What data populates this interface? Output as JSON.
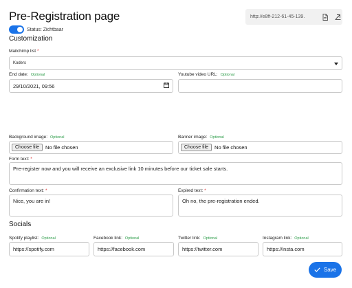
{
  "header": {
    "title": "Pre-Registration page",
    "status_label": "Status: Zichtbaar",
    "toggle_on": true,
    "url": "http://e8ff-212-61-45-139.",
    "file_icon": "document-icon",
    "open_icon": "external-link-icon"
  },
  "customization": {
    "title": "Customization",
    "required_mark": "*",
    "optional_label": "Optional",
    "mailchimp": {
      "label": "Mailchimp list",
      "value": "Koders"
    },
    "end_date": {
      "label": "End date:",
      "value": "29/10/2021, 09:56"
    },
    "youtube": {
      "label": "Youtube video URL:",
      "value": ""
    },
    "background_image": {
      "label": "Background image:",
      "button": "Choose file",
      "status": "No file chosen"
    },
    "banner_image": {
      "label": "Banner image:",
      "button": "Choose file",
      "status": "No file chosen"
    },
    "form_text": {
      "label": "Form text:",
      "value": "Pre-register now and you will receive an exclusive link 10 minutes before our ticket sale starts."
    },
    "confirmation_text": {
      "label": "Confirmation text:",
      "value": "Nice, you are in!"
    },
    "expired_text": {
      "label": "Expired text:",
      "value": "Oh no, the pre-registration ended."
    }
  },
  "socials": {
    "title": "Socials",
    "spotify": {
      "label": "Spotify playlist:",
      "value": "https://spotify.com"
    },
    "facebook": {
      "label": "Facebook link:",
      "value": "https://facebook.com"
    },
    "twitter": {
      "label": "Twitter link:",
      "value": "https://twitter.com"
    },
    "instagram": {
      "label": "Instagram link:",
      "value": "https://insta.com"
    }
  },
  "actions": {
    "save_label": "Save"
  },
  "colors": {
    "accent": "#1a73e8",
    "required": "#dd3333",
    "optional": "#2e9d4a"
  }
}
